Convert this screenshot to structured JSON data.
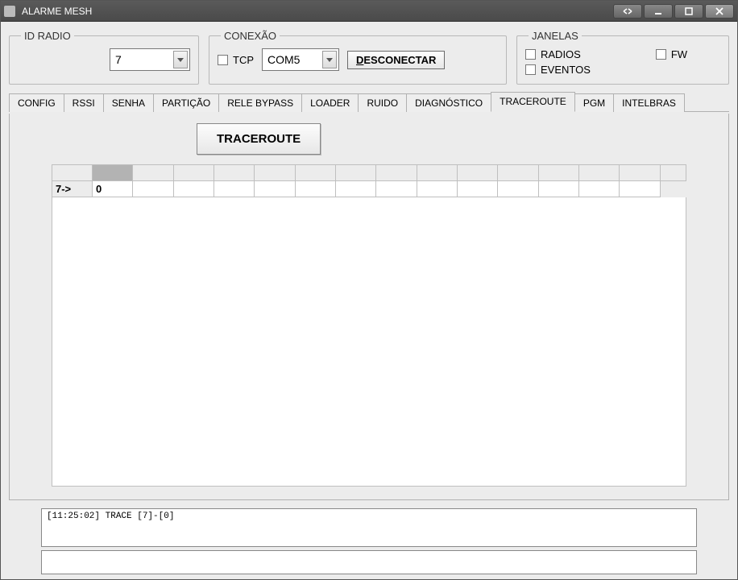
{
  "window": {
    "title": "ALARME MESH"
  },
  "id_radio": {
    "legend": "ID RADIO",
    "value": "7"
  },
  "conexao": {
    "legend": "CONEXÃO",
    "tcp_label": "TCP",
    "tcp_checked": false,
    "port_value": "COM5",
    "disconnect_hotkey": "D",
    "disconnect_rest": "ESCONECTAR"
  },
  "janelas": {
    "legend": "JANELAS",
    "radios_label": "RADIOS",
    "fw_label": "FW",
    "eventos_label": "EVENTOS"
  },
  "tabs": [
    {
      "id": "config",
      "label": "CONFIG"
    },
    {
      "id": "rssi",
      "label": "RSSI"
    },
    {
      "id": "senha",
      "label": "SENHA"
    },
    {
      "id": "particao",
      "label": "PARTIÇÃO"
    },
    {
      "id": "relebypass",
      "label": "RELE BYPASS"
    },
    {
      "id": "loader",
      "label": "LOADER"
    },
    {
      "id": "ruido",
      "label": "RUIDO"
    },
    {
      "id": "diagnostico",
      "label": "DIAGNÓSTICO"
    },
    {
      "id": "traceroute",
      "label": "TRACEROUTE"
    },
    {
      "id": "pgm",
      "label": "PGM"
    },
    {
      "id": "intelbras",
      "label": "INTELBRAS"
    }
  ],
  "active_tab": "traceroute",
  "traceroute": {
    "button_label": "TRACEROUTE",
    "row_head": "7->",
    "first_cell": "0"
  },
  "log": {
    "text": "[11:25:02] TRACE [7]-[0]"
  },
  "input": {
    "value": ""
  }
}
